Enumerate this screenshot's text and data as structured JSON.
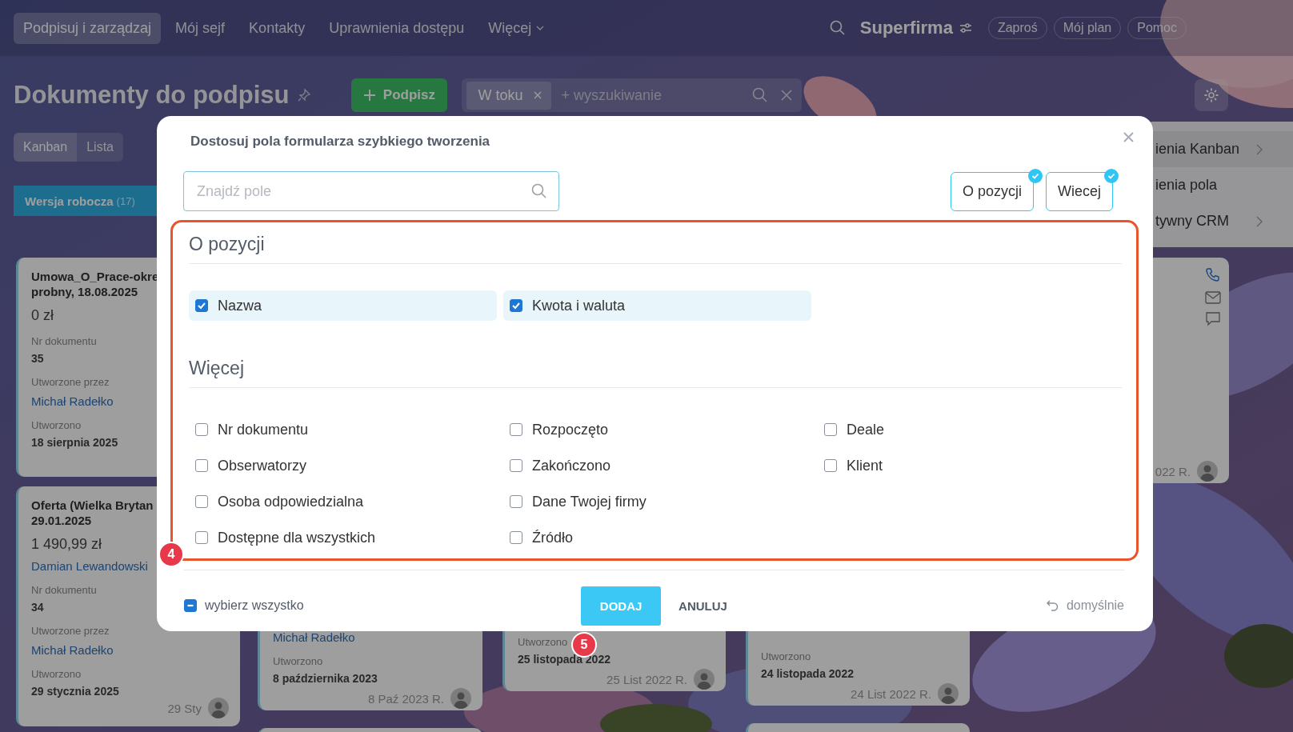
{
  "nav": {
    "items": [
      {
        "label": "Podpisuj i zarządzaj",
        "selected": true,
        "dropdown": false
      },
      {
        "label": "Mój sejf",
        "selected": false,
        "dropdown": false
      },
      {
        "label": "Kontakty",
        "selected": false,
        "dropdown": false
      },
      {
        "label": "Uprawnienia dostępu",
        "selected": false,
        "dropdown": false
      },
      {
        "label": "Więcej",
        "selected": false,
        "dropdown": true
      }
    ],
    "company": "Superfirma",
    "actions": [
      "Zaproś",
      "Mój plan",
      "Pomoc"
    ]
  },
  "header": {
    "title": "Dokumenty do podpisu",
    "create_button": "Podpisz",
    "filter": {
      "tag": "W toku",
      "placeholder": "+ wyszukiwanie"
    }
  },
  "views": [
    {
      "label": "Kanban",
      "selected": true
    },
    {
      "label": "Lista",
      "selected": false
    }
  ],
  "settings_menu": [
    {
      "label": "ienia Kanban",
      "submenu": true
    },
    {
      "label": "ienia pola",
      "submenu": false
    },
    {
      "label": "tywny CRM",
      "submenu": true
    }
  ],
  "columns": [
    {
      "header": {
        "title": "Wersja robocza",
        "count": "(17)"
      },
      "cards": [
        {
          "fields": [
            {
              "kind": "title",
              "text": "Umowa_O_Prace-okre"
            },
            {
              "kind": "title",
              "text": "probny, 18.08.2025"
            },
            {
              "kind": "amount",
              "text": "0 zł"
            },
            {
              "kind": "label",
              "text": "Nr dokumentu"
            },
            {
              "kind": "value",
              "text": "35"
            },
            {
              "kind": "label",
              "text": "Utworzone przez"
            },
            {
              "kind": "person",
              "text": "Michał Radełko"
            },
            {
              "kind": "label",
              "text": "Utworzono"
            },
            {
              "kind": "value",
              "text": "18 sierpnia 2025"
            }
          ]
        },
        {
          "fields": [
            {
              "kind": "title",
              "text": "Oferta (Wielka Brytan"
            },
            {
              "kind": "title",
              "text": "29.01.2025"
            },
            {
              "kind": "amount",
              "text": "1 490,99 zł"
            },
            {
              "kind": "person",
              "text": "Damian Lewandowski"
            },
            {
              "kind": "label",
              "text": "Nr dokumentu"
            },
            {
              "kind": "value",
              "text": "34"
            },
            {
              "kind": "label",
              "text": "Utworzone przez"
            },
            {
              "kind": "person",
              "text": "Michał Radełko"
            },
            {
              "kind": "label",
              "text": "Utworzono"
            },
            {
              "kind": "value",
              "text": "29 stycznia 2025"
            }
          ],
          "footer": "29 Sty"
        }
      ]
    },
    {
      "cards": [
        {
          "fields": [
            {
              "kind": "person",
              "text": "Michał Radełko"
            },
            {
              "kind": "label",
              "text": "Utworzono"
            },
            {
              "kind": "value",
              "text": "8 października 2023"
            }
          ],
          "footer": "8 Paź 2023 R."
        }
      ],
      "more_below": true
    },
    {
      "cards": [
        {
          "fields": [
            {
              "kind": "label",
              "text": "Utworzono"
            },
            {
              "kind": "value",
              "text": "25 listopada 2022"
            }
          ],
          "footer": "25 List 2022 R."
        }
      ]
    },
    {
      "cards": [
        {
          "fields": [
            {
              "kind": "label",
              "text": "Utworzono"
            },
            {
              "kind": "value",
              "text": "24 listopada 2022"
            }
          ],
          "footer": "24 List 2022 R."
        }
      ],
      "more_below": true
    },
    {
      "cards": [
        {
          "contacts": true,
          "footer": "022 R."
        }
      ]
    }
  ],
  "modal": {
    "title": "Dostosuj pola formularza szybkiego tworzenia",
    "search_placeholder": "Znajdź pole",
    "section_chips": [
      {
        "label": "O pozycji",
        "selected": true
      },
      {
        "label": "Wiecej",
        "selected": true
      }
    ],
    "highlight_badge": "4",
    "sections": [
      {
        "title": "O pozycji",
        "fields": [
          {
            "label": "Nazwa",
            "checked": true
          },
          {
            "label": "Kwota i waluta",
            "checked": true
          }
        ]
      },
      {
        "title": "Więcej",
        "fields": [
          {
            "label": "Nr dokumentu",
            "checked": false
          },
          {
            "label": "Obserwatorzy",
            "checked": false
          },
          {
            "label": "Osoba odpowiedzialna",
            "checked": false
          },
          {
            "label": "Dostępne dla wszystkich",
            "checked": false
          },
          {
            "label": "Rozpoczęto",
            "checked": false
          },
          {
            "label": "Zakończono",
            "checked": false
          },
          {
            "label": "Dane Twojej firmy",
            "checked": false
          },
          {
            "label": "Źródło",
            "checked": false
          },
          {
            "label": "Deale",
            "checked": false
          },
          {
            "label": "Klient",
            "checked": false
          }
        ]
      }
    ],
    "select_all": {
      "label": "wybierz wszystko",
      "indeterminate": true
    },
    "add_button": "DODAJ",
    "add_badge": "5",
    "cancel_button": "ANULUJ",
    "reset_link": "domyślnie"
  }
}
